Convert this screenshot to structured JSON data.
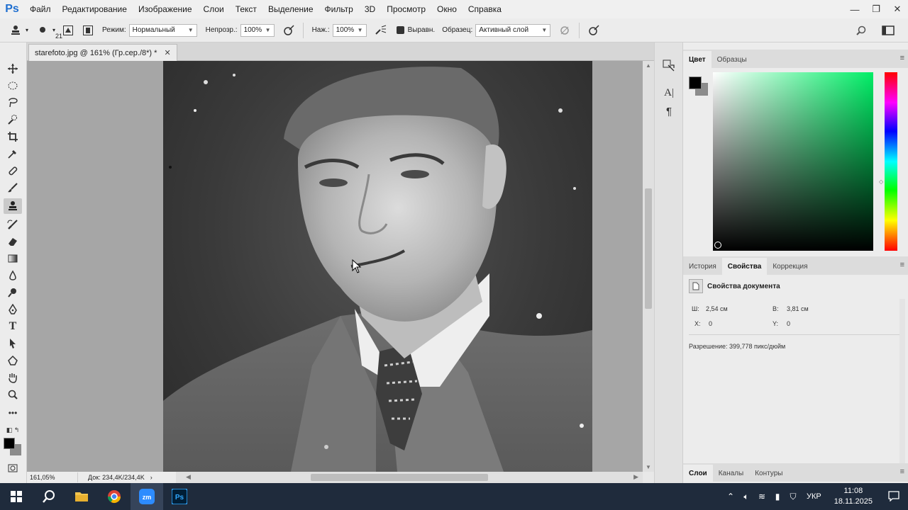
{
  "app": {
    "logo": "Ps",
    "menu": [
      "Файл",
      "Редактирование",
      "Изображение",
      "Слои",
      "Текст",
      "Выделение",
      "Фильтр",
      "3D",
      "Просмотр",
      "Окно",
      "Справка"
    ],
    "window_controls": {
      "minimize": "—",
      "restore": "❐",
      "close": "✕"
    }
  },
  "options": {
    "brush_size": "21",
    "mode_label": "Режим:",
    "mode_value": "Нормальный",
    "opacity_label": "Непрозр.:",
    "opacity_value": "100%",
    "pressure_label": "Наж.:",
    "pressure_value": "100%",
    "aligned_label": "Выравн.",
    "sample_label": "Образец:",
    "sample_value": "Активный слой"
  },
  "document": {
    "tab_title": "starefoto.jpg @ 161% (Гр.сер./8*) *",
    "zoom": "161,05%",
    "doc_size": "Док: 234,4K/234,4K"
  },
  "panels": {
    "color_tabs": [
      "Цвет",
      "Образцы"
    ],
    "props_tabs": [
      "История",
      "Свойства",
      "Коррекция"
    ],
    "props_title": "Свойства документа",
    "width_label": "Ш:",
    "width_value": "2,54 см",
    "height_label": "В:",
    "height_value": "3,81 см",
    "x_label": "X:",
    "x_value": "0",
    "y_label": "Y:",
    "y_value": "0",
    "resolution": "Разрешение: 399,778 пикс/дюйм",
    "layers_tabs": [
      "Слои",
      "Каналы",
      "Контуры"
    ]
  },
  "taskbar": {
    "lang": "УКР",
    "time": "11:08",
    "date": "18.11.2025"
  },
  "colors": {
    "foreground": "#000000",
    "background": "#8c8c8c",
    "taskbar": "#1f2b3c"
  }
}
